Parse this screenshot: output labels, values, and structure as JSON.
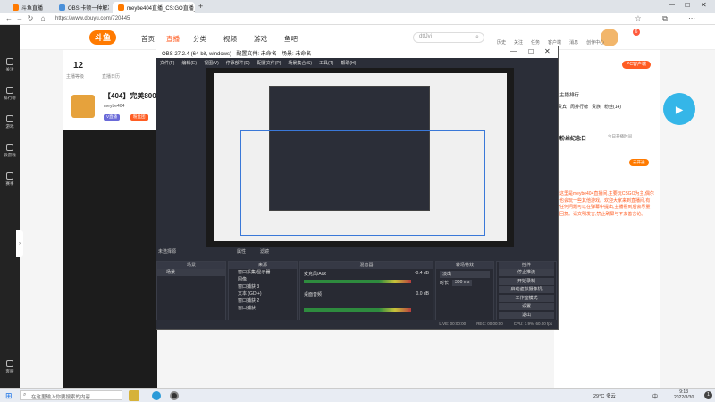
{
  "browser": {
    "tabs": [
      {
        "label": "斗鱼直播",
        "color": "#ff7a00"
      },
      {
        "label": "OBS 卡顿一种解决方法",
        "color": "#4a90d9"
      },
      {
        "label": "meybe404直播_CS:GO直播_斗鱼",
        "color": "#ff7a00"
      }
    ],
    "new_tab": "+",
    "url": "https://www.douyu.com/720445"
  },
  "site": {
    "logo_text": "斗鱼",
    "nav": [
      "首页",
      "直播",
      "分类",
      "视频",
      "游戏",
      "鱼吧"
    ],
    "search_placeholder": "dtfJvi",
    "header_icons": [
      "历史",
      "关注",
      "任务",
      "客户端",
      "消息",
      "创作中心"
    ],
    "left_nav": [
      "关注",
      "排行榜",
      "游戏",
      "云游戏",
      "赛事",
      "客服"
    ],
    "room": {
      "level": "12",
      "level_label": "主播等级",
      "bonus": "直播日历",
      "title": "【404】完美800分",
      "streamer": "meybe404",
      "tag": "斗鱼认证",
      "notice_label": "V直播",
      "fans_badge": "粉丝团"
    },
    "rightpanel": {
      "pc_badge": "PC客户端",
      "streamer_rank": "主播排行",
      "tabs": [
        "贵宾",
        "周排行榜",
        "贵族",
        "粉丝(14)"
      ],
      "vip_btn": "去开通",
      "notice_title": "粉丝纪念日",
      "notice_sub": "今日开播时间",
      "description": "这里是meybe404直播间,主要玩CSGO为主,偶尔也会玩一些其他游戏。欢迎大家来到直播间,有任何问题可以在弹幕中提出,主播看到后会尽量回复。请文明发言,禁止刷屏与不友善言论。"
    }
  },
  "obs": {
    "title": "OBS 27.2.4 (64-bit, windows) - 配置文件: 未命名 - 场景: 未命名",
    "menu": [
      "文件(F)",
      "编辑(E)",
      "视图(V)",
      "停靠部件(D)",
      "配置文件(P)",
      "场景集合(S)",
      "工具(T)",
      "帮助(H)"
    ],
    "no_source": "未选择源",
    "filter_btn": "属性",
    "filter_btn2": "滤镜",
    "scenes_header": "场景",
    "scenes": [
      "场景"
    ],
    "sources_header": "来源",
    "sources": [
      "窗口采集/显示器",
      "图像",
      "窗口捕获 3",
      "文本 (GDI+)",
      "窗口捕获 2",
      "窗口捕获"
    ],
    "mixer_header": "混音器",
    "mixer": [
      {
        "name": "麦克风/Aux",
        "db": "-0.4 dB"
      },
      {
        "name": "桌面音频",
        "db": "0.0 dB"
      }
    ],
    "transitions_header": "转场特效",
    "transition_type": "淡出",
    "duration_label": "时长",
    "duration_value": "300 ms",
    "controls_header": "控件",
    "controls": [
      "停止推流",
      "开始录制",
      "启动虚拟摄像机",
      "工作室模式",
      "设置",
      "退出"
    ],
    "status": {
      "live": "LIVE: 00:00:00",
      "rec": "REC: 00:00:00",
      "cpu": "CPU: 1.9%, 60.00 fps"
    }
  },
  "taskbar": {
    "search_placeholder": "在这里输入你要搜索的内容",
    "weather": "29°C 多云",
    "lang": "中",
    "time": "9:13",
    "date": "2022/8/30",
    "notif_count": "1"
  }
}
